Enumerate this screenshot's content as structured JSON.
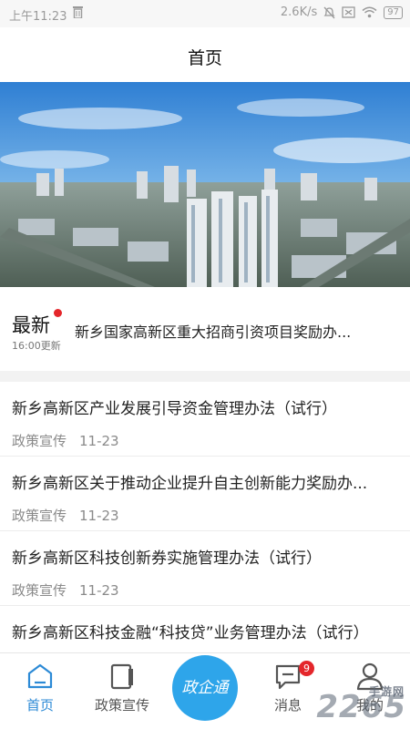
{
  "status_bar": {
    "time": "上午11:23",
    "network_speed": "2.6K/s",
    "battery": "97"
  },
  "header": {
    "title": "首页"
  },
  "banner": {
    "image": "city-skyline-photo"
  },
  "latest": {
    "label": "最新",
    "updated": "16:00更新",
    "headline": "新乡国家高新区重大招商引资项目奖励办..."
  },
  "news": [
    {
      "title": "新乡高新区产业发展引导资金管理办法（试行）",
      "category": "政策宣传",
      "date": "11-23"
    },
    {
      "title": "新乡高新区关于推动企业提升自主创新能力奖励办...",
      "category": "政策宣传",
      "date": "11-23"
    },
    {
      "title": "新乡高新区科技创新券实施管理办法（试行）",
      "category": "政策宣传",
      "date": "11-23"
    },
    {
      "title": "新乡高新区科技金融“科技贷”业务管理办法（试行）",
      "category": "",
      "date": ""
    }
  ],
  "tabs": {
    "home": "首页",
    "policy": "政策宣传",
    "center": "政企通",
    "messages": "消息",
    "messages_badge": "9",
    "mine": "我的"
  },
  "watermark": {
    "main": "2265",
    "sub": "手游网"
  },
  "colors": {
    "accent": "#2c8ad6",
    "center_button": "#2ea5ea",
    "badge": "#e4262b"
  }
}
